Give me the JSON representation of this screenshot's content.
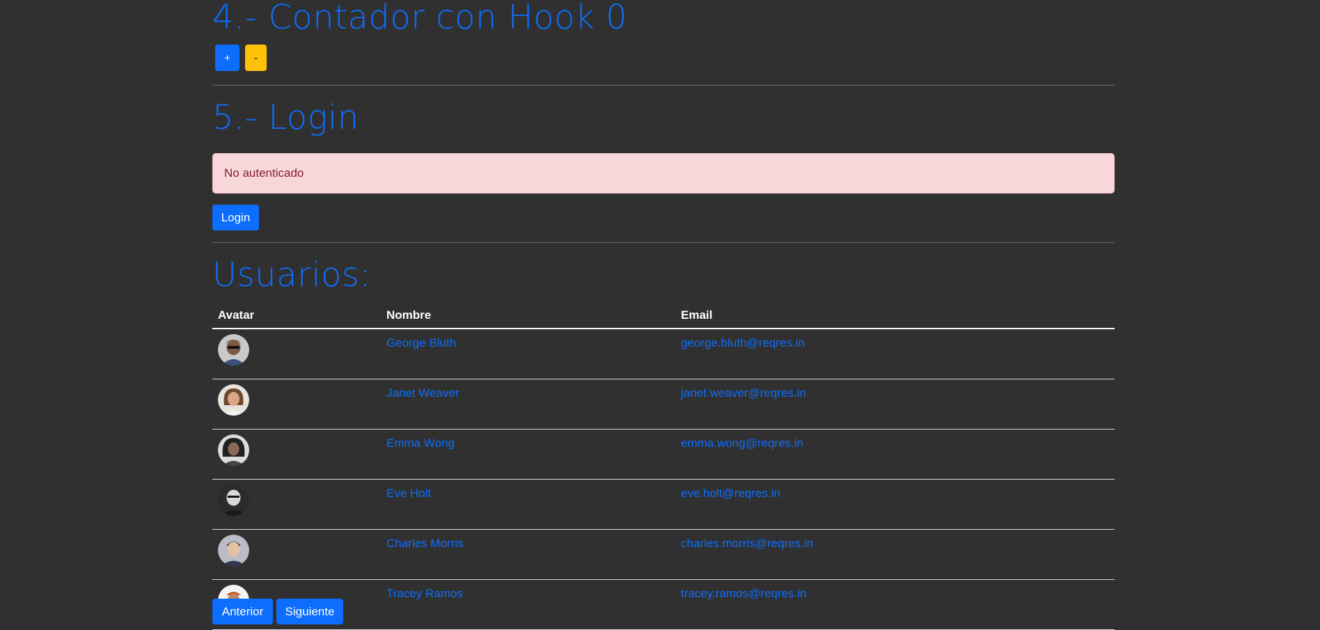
{
  "counter": {
    "title": "4.- Contador con Hook",
    "value": "0",
    "plus_label": "+",
    "minus_label": "-"
  },
  "login": {
    "title": "5.- Login",
    "alert_text": "No autenticado",
    "button_label": "Login"
  },
  "users": {
    "title": "Usuarios:",
    "columns": [
      "Avatar",
      "Nombre",
      "Email"
    ],
    "rows": [
      {
        "name": "George Bluth",
        "email": "george.bluth@reqres.in"
      },
      {
        "name": "Janet Weaver",
        "email": "janet.weaver@reqres.in"
      },
      {
        "name": "Emma Wong",
        "email": "emma.wong@reqres.in"
      },
      {
        "name": "Eve Holt",
        "email": "eve.holt@reqres.in"
      },
      {
        "name": "Charles Morris",
        "email": "charles.morris@reqres.in"
      },
      {
        "name": "Tracey Ramos",
        "email": "tracey.ramos@reqres.in"
      }
    ],
    "prev_label": "Anterior",
    "next_label": "Siguiente"
  },
  "colors": {
    "background": "#303030",
    "primary": "#0d6efd",
    "warning": "#ffc107",
    "alert_bg": "#f8d7da",
    "alert_text": "#842029"
  }
}
